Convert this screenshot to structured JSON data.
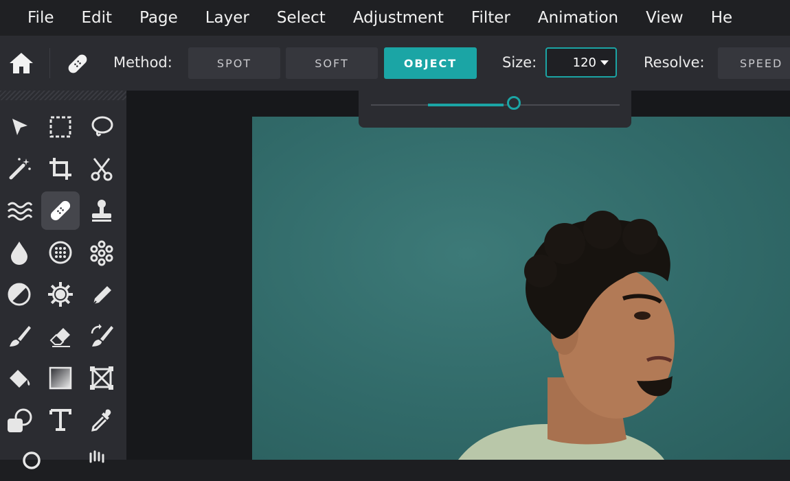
{
  "menu": {
    "items": [
      "File",
      "Edit",
      "Page",
      "Layer",
      "Select",
      "Adjustment",
      "Filter",
      "Animation",
      "View",
      "He"
    ]
  },
  "options": {
    "method_label": "Method:",
    "methods": [
      "SPOT",
      "SOFT",
      "OBJECT"
    ],
    "active_method": "OBJECT",
    "size_label": "Size:",
    "size_value": "120",
    "resolve_label": "Resolve:",
    "resolve_first_option": "SPEED"
  },
  "size_slider": {
    "value_fraction": 0.58
  },
  "toolbox": {
    "tools": [
      "select-arrow-icon",
      "marquee-select-icon",
      "lasso-icon",
      "magic-wand-icon",
      "crop-icon",
      "scissors-icon",
      "liquify-icon",
      "healing-bandage-icon",
      "stamp-icon",
      "blur-drop-icon",
      "sponge-icon",
      "pattern-dots-icon",
      "dodge-burn-icon",
      "sharpen-gear-icon",
      "pen-icon",
      "brush-icon",
      "eraser-icon",
      "replace-brush-icon",
      "paint-bucket-icon",
      "gradient-icon",
      "shape-frame-icon",
      "shape-icon",
      "text-icon",
      "eyedropper-icon"
    ],
    "active_tool": "healing-bandage-icon"
  },
  "colors": {
    "accent": "#1ba5a5",
    "panel": "#2b2c31",
    "menubar": "#1f2023",
    "canvas": "#17181b",
    "photo_background": "#316a69"
  }
}
